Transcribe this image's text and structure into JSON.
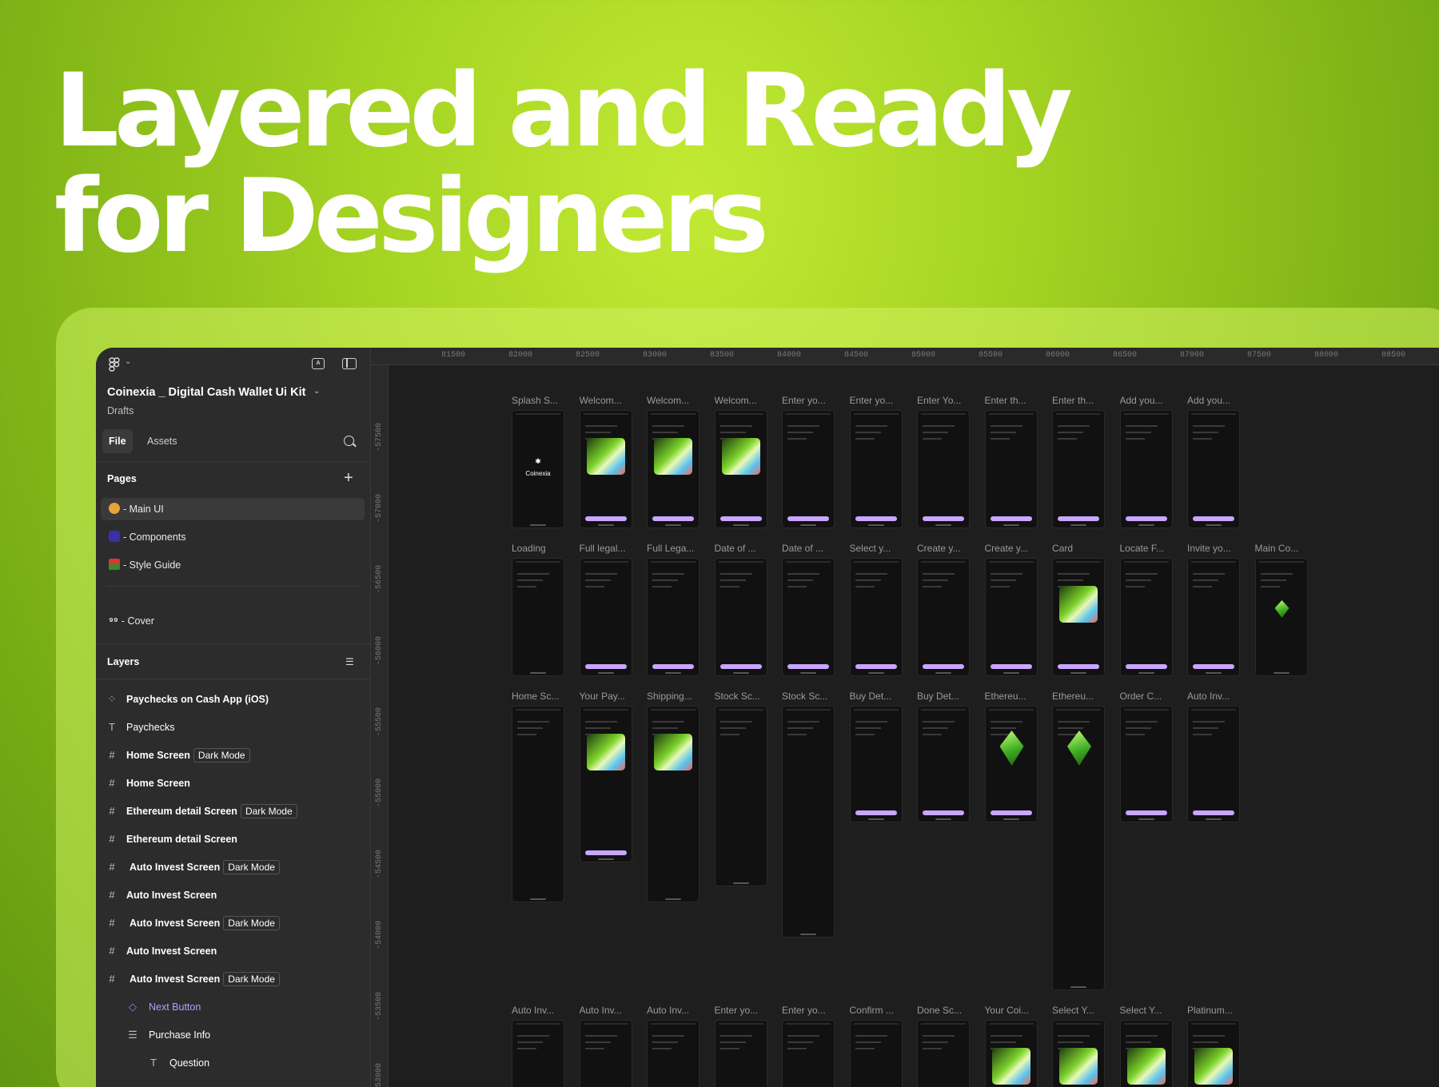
{
  "headline": {
    "line1": "Layered and Ready",
    "line2": "for Designers"
  },
  "sidebar": {
    "file_title": "Coinexia _ Digital Cash Wallet Ui Kit",
    "file_subtitle": "Drafts",
    "tabs": {
      "file": "File",
      "assets": "Assets"
    },
    "pages_label": "Pages",
    "pages": [
      {
        "label": "- Main UI",
        "emoji_color": "#e8a23a"
      },
      {
        "label": "- Components",
        "emoji_color": "#3b2fa8"
      },
      {
        "label": "- Style Guide",
        "emoji_color": "#d8382e"
      },
      {
        "label": "- Cover",
        "emoji_glyph": "⁹⁹"
      }
    ],
    "layers_label": "Layers",
    "layers": [
      {
        "icon": "component-set-icon",
        "name": "Paychecks on Cash App (iOS)",
        "badge": ""
      },
      {
        "icon": "text-icon",
        "name": "Paychecks",
        "badge": ""
      },
      {
        "icon": "frame-icon",
        "name": "Home Screen",
        "badge": "Dark Mode"
      },
      {
        "icon": "frame-icon",
        "name": "Home Screen",
        "badge": ""
      },
      {
        "icon": "frame-icon",
        "name": "Ethereum detail Screen",
        "badge": "Dark Mode"
      },
      {
        "icon": "frame-icon",
        "name": "Ethereum detail Screen",
        "badge": ""
      },
      {
        "icon": "frame-icon",
        "name": "Auto Invest Screen",
        "badge": "Dark Mode"
      },
      {
        "icon": "frame-icon",
        "name": "Auto Invest Screen",
        "badge": ""
      },
      {
        "icon": "frame-icon",
        "name": "Auto Invest Screen",
        "badge": "Dark Mode"
      },
      {
        "icon": "frame-icon",
        "name": "Auto Invest Screen",
        "badge": ""
      },
      {
        "icon": "frame-icon",
        "name": "Auto Invest Screen",
        "badge": "Dark Mode"
      },
      {
        "icon": "instance-icon",
        "name": "Next Button",
        "badge": ""
      },
      {
        "icon": "autolayout-icon",
        "name": "Purchase Info",
        "badge": ""
      },
      {
        "icon": "text-icon",
        "name": "Question",
        "badge": ""
      }
    ]
  },
  "canvas": {
    "ruler_top": [
      "81500",
      "82000",
      "82500",
      "83000",
      "83500",
      "84000",
      "84500",
      "85000",
      "85500",
      "86000",
      "86500",
      "87000",
      "87500",
      "88000",
      "88500"
    ],
    "ruler_left": [
      "-57500",
      "-57000",
      "-56500",
      "-56000",
      "-55500",
      "-55000",
      "-54500",
      "-54000",
      "-53500",
      "-53000"
    ],
    "rows": [
      {
        "frames": [
          "Splash S...",
          "Welcom...",
          "Welcom...",
          "Welcom...",
          "Enter yo...",
          "Enter yo...",
          "Enter Yo...",
          "Enter th...",
          "Enter th...",
          "Add you...",
          "Add you..."
        ]
      },
      {
        "frames": [
          "Loading",
          "Full legal...",
          "Full Lega...",
          "Date of ...",
          "Date of ...",
          "Select y...",
          "Create y...",
          "Create y...",
          "Card",
          "Locate F...",
          "Invite yo...",
          "Main Co..."
        ]
      },
      {
        "frames": [
          "Home Sc...",
          "Your Pay...",
          "Shipping...",
          "Stock Sc...",
          "Stock Sc...",
          "Buy Det...",
          "Buy Det...",
          "Ethereu...",
          "Ethereu...",
          "Order C...",
          "Auto Inv..."
        ]
      },
      {
        "frames": [
          "Auto Inv...",
          "Auto Inv...",
          "Auto Inv...",
          "Enter yo...",
          "Enter yo...",
          "Confirm ...",
          "Done Sc...",
          "Your Coi...",
          "Select Y...",
          "Select Y...",
          "Platinum..."
        ]
      }
    ],
    "splash_text": "Coinexia"
  },
  "colors": {
    "accent_lime": "#a5d423",
    "button_purple": "#c9a6ff",
    "selection_purple": "#b99bff"
  }
}
